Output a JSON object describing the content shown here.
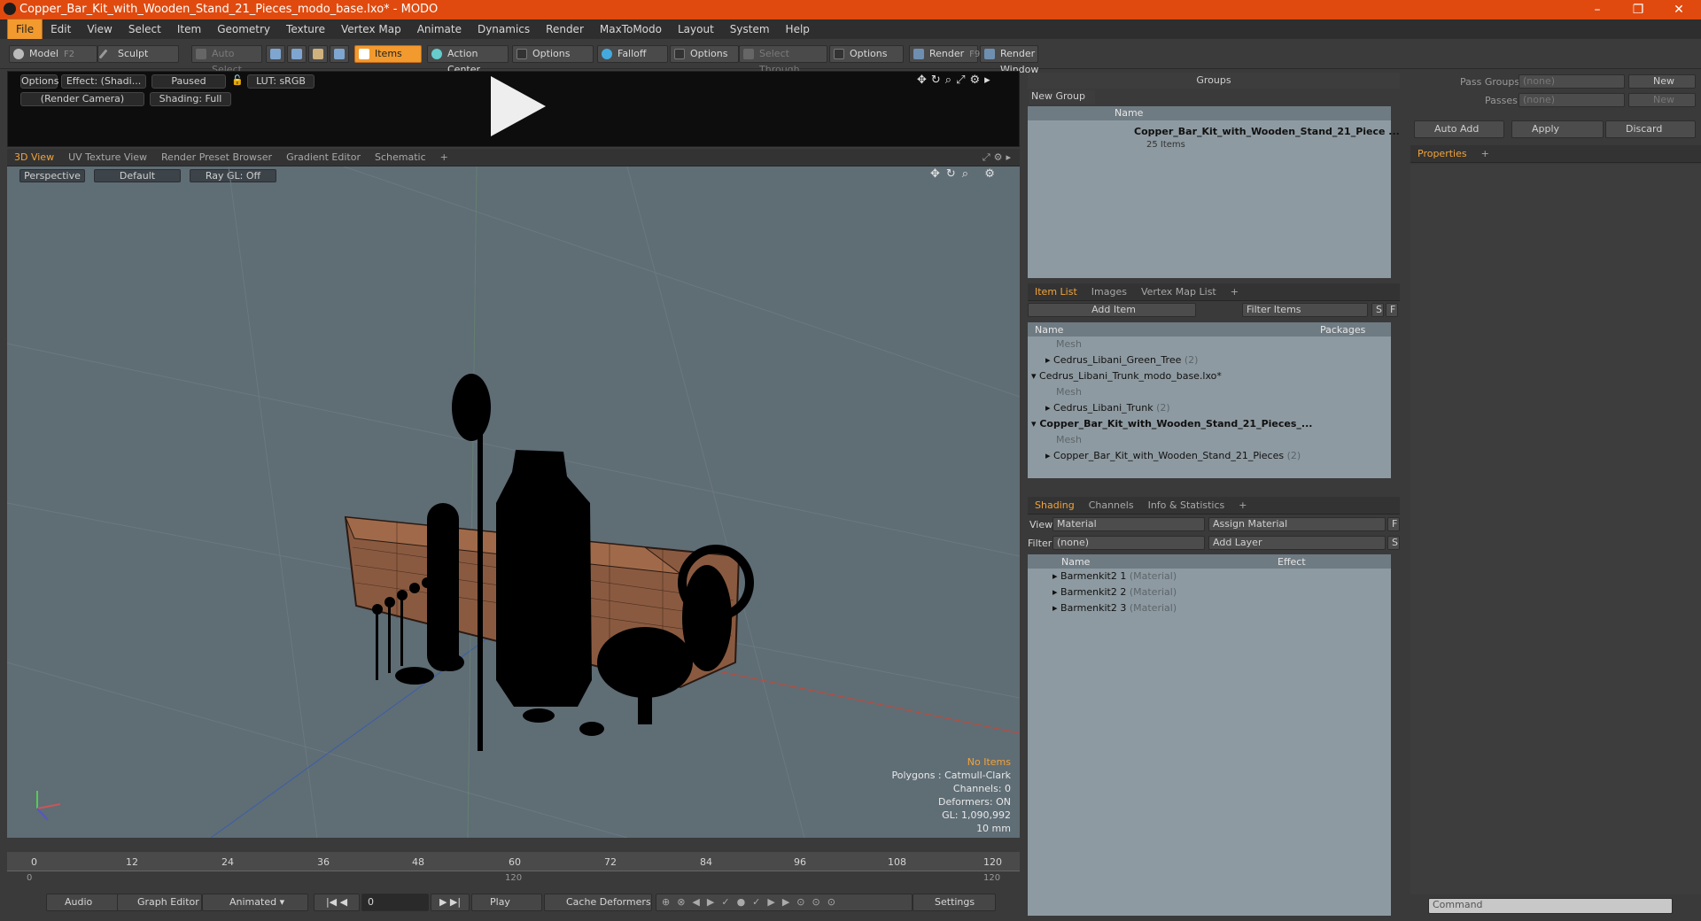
{
  "window": {
    "title": "Copper_Bar_Kit_with_Wooden_Stand_21_Pieces_modo_base.lxo* - MODO",
    "min": "–",
    "max": "❐",
    "close": "✕"
  },
  "menu": [
    "File",
    "Edit",
    "View",
    "Select",
    "Item",
    "Geometry",
    "Texture",
    "Vertex Map",
    "Animate",
    "Dynamics",
    "Render",
    "MaxToModo",
    "Layout",
    "System",
    "Help"
  ],
  "toolbar": {
    "model": "Model",
    "model_key": "F2",
    "sculpt": "Sculpt",
    "auto_select": "Auto Select",
    "items": "Items",
    "action_center": "Action Center",
    "options1": "Options",
    "falloff": "Falloff",
    "options2": "Options",
    "select_through": "Select Through",
    "options3": "Options",
    "render": "Render",
    "render_key": "F9",
    "render_window": "Render Window"
  },
  "preview": {
    "options": "Options",
    "effect": "Effect: (Shadi...",
    "paused": "Paused",
    "lut": "LUT: sRGB",
    "camera": "(Render Camera)",
    "shading": "Shading: Full"
  },
  "view_tabs": [
    "3D View",
    "UV Texture View",
    "Render Preset Browser",
    "Gradient Editor",
    "Schematic",
    "+"
  ],
  "viewport": {
    "perspective": "Perspective",
    "default": "Default",
    "raygl": "Ray GL: Off",
    "no_items": "No Items",
    "polygons": "Polygons : Catmull-Clark",
    "channels": "Channels: 0",
    "deformers": "Deformers: ON",
    "gl": "GL: 1,090,992",
    "size": "10 mm"
  },
  "timeline": {
    "ticks": [
      "0",
      "12",
      "24",
      "36",
      "48",
      "60",
      "72",
      "84",
      "96",
      "108",
      "120"
    ],
    "sub": [
      "0",
      "120",
      "120"
    ]
  },
  "bottom": {
    "audio": "Audio",
    "graph_editor": "Graph Editor",
    "animated": "Animated",
    "frame": "0",
    "play": "Play",
    "cache": "Cache Deformers",
    "settings": "Settings"
  },
  "groups": {
    "title": "Groups",
    "new_group": "New Group",
    "col_name": "Name",
    "item": "Copper_Bar_Kit_with_Wooden_Stand_21_Piece ...",
    "count": "25 Items"
  },
  "itemlist": {
    "tabs": [
      "Item List",
      "Images",
      "Vertex Map List",
      "+"
    ],
    "add_item": "Add Item",
    "filter": "Filter Items",
    "s": "S",
    "f": "F",
    "col_name": "Name",
    "col_packages": "Packages",
    "rows": [
      {
        "text": "Mesh",
        "level": 2,
        "dim": true
      },
      {
        "text": "Cedrus_Libani_Green_Tree",
        "count": "(2)",
        "level": 1
      },
      {
        "text": "Cedrus_Libani_Trunk_modo_base.lxo*",
        "level": 0
      },
      {
        "text": "Mesh",
        "level": 2,
        "dim": true
      },
      {
        "text": "Cedrus_Libani_Trunk",
        "count": "(2)",
        "level": 1
      },
      {
        "text": "Copper_Bar_Kit_with_Wooden_Stand_21_Pieces_...",
        "level": 0,
        "bold": true
      },
      {
        "text": "Mesh",
        "level": 2,
        "dim": true
      },
      {
        "text": "Copper_Bar_Kit_with_Wooden_Stand_21_Pieces",
        "count": "(2)",
        "level": 1
      }
    ]
  },
  "shading": {
    "tabs": [
      "Shading",
      "Channels",
      "Info & Statistics",
      "+"
    ],
    "view_label": "View",
    "view_value": "Material",
    "assign": "Assign Material",
    "filter_label": "Filter",
    "filter_value": "(none)",
    "add_layer": "Add Layer",
    "f": "F",
    "s": "S",
    "col_name": "Name",
    "col_effect": "Effect",
    "rows": [
      {
        "name": "Barmenkit2 1",
        "type": "(Material)"
      },
      {
        "name": "Barmenkit2 2",
        "type": "(Material)"
      },
      {
        "name": "Barmenkit2 3",
        "type": "(Material)"
      }
    ]
  },
  "right": {
    "pass_groups": "Pass Groups",
    "passes": "Passes",
    "none1": "(none)",
    "none2": "(none)",
    "new1": "New",
    "new2": "New",
    "auto_add": "Auto Add",
    "apply": "Apply",
    "discard": "Discard",
    "properties": "Properties",
    "plus": "+",
    "command": "Command"
  }
}
